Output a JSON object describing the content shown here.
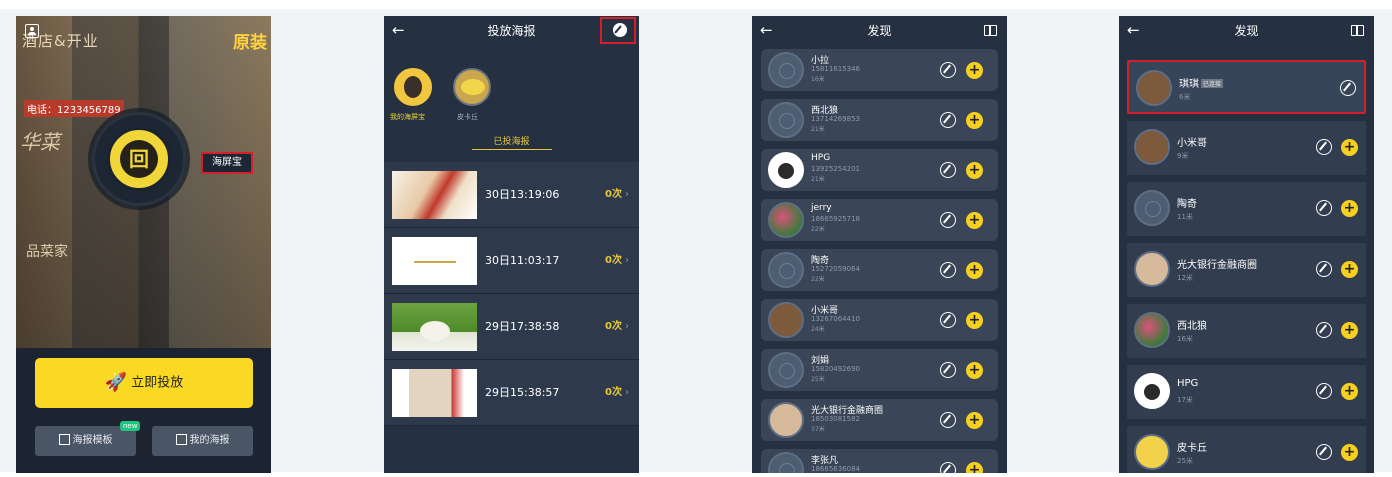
{
  "phone1": {
    "collage": {
      "title_text": "酒店&开业",
      "brand_text": "原装",
      "phone_text": "电话：1233456789",
      "art1": "华菜",
      "art2": "品菜家"
    },
    "badge_glyph": "回",
    "haipingbao": "海屏宝",
    "cast_button": "立即投放",
    "template_button": "海报模板",
    "new_tag": "new",
    "my_poster_button": "我的海报"
  },
  "phone2": {
    "title": "投放海报",
    "back": "←",
    "avatars": [
      {
        "label": "我的海屏宝"
      },
      {
        "label": "皮卡丘"
      }
    ],
    "section_title": "已投海报",
    "rows": [
      {
        "time": "30日13:19:06",
        "count": "0次"
      },
      {
        "time": "30日11:03:17",
        "count": "0次"
      },
      {
        "time": "29日17:38:58",
        "count": "0次"
      },
      {
        "time": "29日15:38:57",
        "count": "0次"
      }
    ]
  },
  "phone3": {
    "title": "发现",
    "back": "←",
    "items": [
      {
        "name": "小拉",
        "phone": "15811615346",
        "dist": "16米"
      },
      {
        "name": "西北狼",
        "phone": "13714269853",
        "dist": "21米"
      },
      {
        "name": "HPG",
        "phone": "13925254201",
        "dist": "21米"
      },
      {
        "name": "jerry",
        "phone": "18665925718",
        "dist": "22米"
      },
      {
        "name": "陶奇",
        "phone": "15272059064",
        "dist": "22米"
      },
      {
        "name": "小米哥",
        "phone": "13267064410",
        "dist": "24米"
      },
      {
        "name": "刘娟",
        "phone": "15820492690",
        "dist": "25米"
      },
      {
        "name": "光大银行金融商圈",
        "phone": "18503081582",
        "dist": "37米"
      },
      {
        "name": "李张凡",
        "phone": "18665636084",
        "dist": ""
      }
    ]
  },
  "phone4": {
    "title": "发现",
    "back": "←",
    "items": [
      {
        "name": "琪琪",
        "tag": "已连接",
        "dist": "6米"
      },
      {
        "name": "小米哥",
        "dist": "9米"
      },
      {
        "name": "陶奇",
        "dist": "11米"
      },
      {
        "name": "光大银行金融商圈",
        "dist": "12米"
      },
      {
        "name": "西北狼",
        "dist": "16米"
      },
      {
        "name": "HPG",
        "dist": "17米"
      },
      {
        "name": "皮卡丘",
        "dist": "25米"
      }
    ]
  }
}
